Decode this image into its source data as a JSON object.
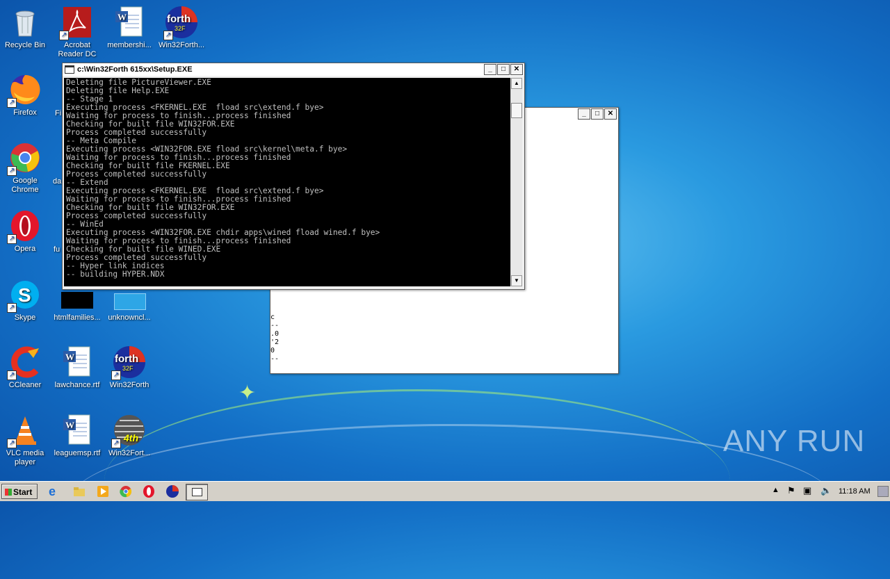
{
  "desktop": {
    "icons": [
      {
        "label": "Recycle Bin"
      },
      {
        "label": "Acrobat Reader DC"
      },
      {
        "label": "membershi..."
      },
      {
        "label": "Win32Forth..."
      },
      {
        "label": "Firefox"
      },
      {
        "label": "Google Chrome"
      },
      {
        "label": "Opera"
      },
      {
        "label": "Skype"
      },
      {
        "label": "htmlfamilies..."
      },
      {
        "label": "unknowncl..."
      },
      {
        "label": "CCleaner"
      },
      {
        "label": "lawchance.rtf"
      },
      {
        "label": "Win32Forth"
      },
      {
        "label": "VLC media player"
      },
      {
        "label": "leaguemsp.rtf"
      },
      {
        "label": "Win32Fort..."
      }
    ],
    "partial_labels": [
      "Fi",
      "da",
      "fu"
    ]
  },
  "console_window": {
    "title": "c:\\Win32Forth 615xx\\Setup.EXE",
    "lines": [
      "Deleting file PictureViewer.EXE",
      "Deleting file Help.EXE",
      "-- Stage 1",
      "Executing process <FKERNEL.EXE  fload src\\extend.f bye>",
      "Waiting for process to finish...process finished",
      "Checking for built file WIN32FOR.EXE",
      "Process completed successfully",
      "-- Meta Compile",
      "Executing process <WIN32FOR.EXE fload src\\kernel\\meta.f bye>",
      "Waiting for process to finish...process finished",
      "Checking for built file FKERNEL.EXE",
      "Process completed successfully",
      "-- Extend",
      "Executing process <FKERNEL.EXE  fload src\\extend.f bye>",
      "Waiting for process to finish...process finished",
      "Checking for built file WIN32FOR.EXE",
      "Process completed successfully",
      "-- WinEd",
      "Executing process <WIN32FOR.EXE chdir apps\\wined fload wined.f bye>",
      "Waiting for process to finish...process finished",
      "Checking for built file WINED.EXE",
      "Process completed successfully",
      "-- Hyper link indices",
      "-- building HYPER.NDX"
    ]
  },
  "back_window": {
    "fragments": [
      "c",
      "--",
      ".0",
      "'2",
      "0",
      "--"
    ]
  },
  "taskbar": {
    "start_label": "Start",
    "clock": "11:18 AM"
  },
  "watermark": {
    "text": "ANY RUN"
  },
  "colors": {
    "console_bg": "#000000",
    "console_fg": "#c0c0c0",
    "taskbar": "#d4d0c8"
  }
}
